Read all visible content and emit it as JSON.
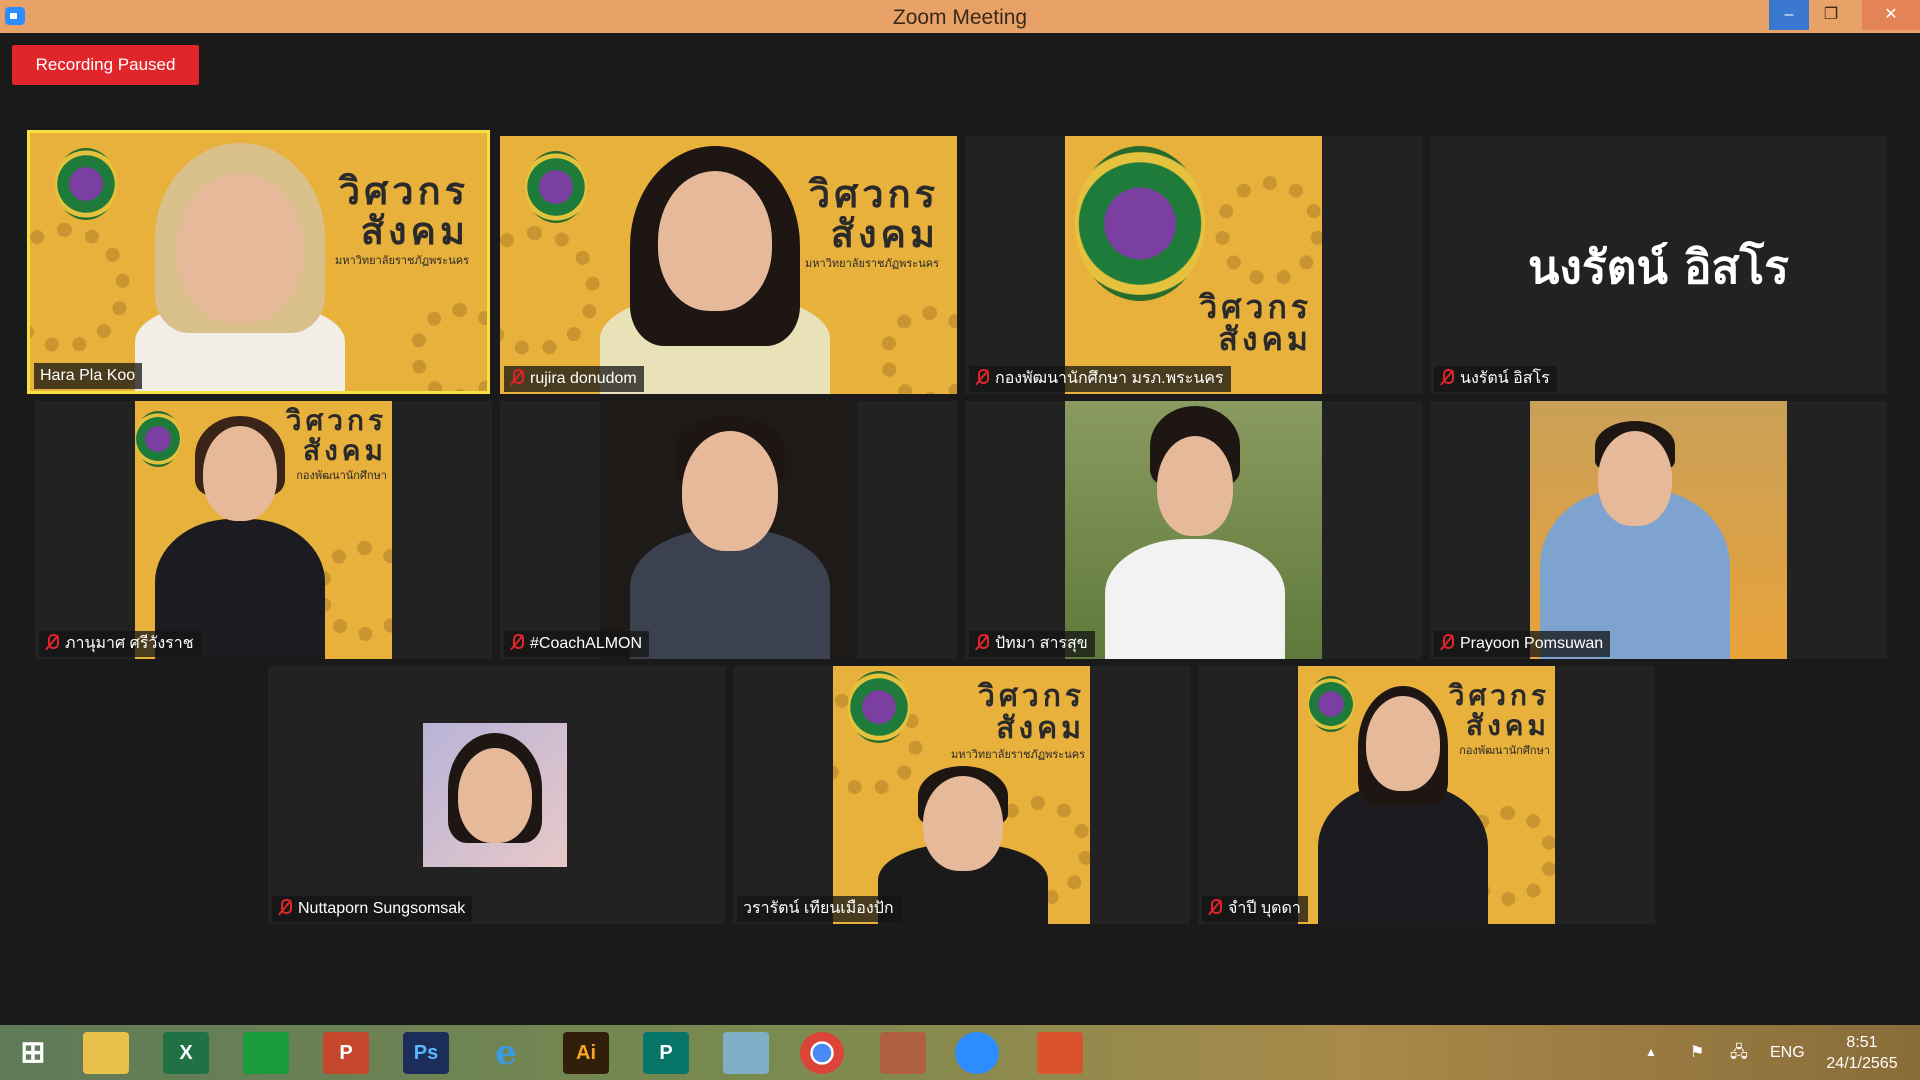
{
  "window": {
    "title": "Zoom Meeting",
    "minimize": "–",
    "restore": "❐",
    "close": "✕"
  },
  "recording_status": "Recording Paused",
  "banner": {
    "title_line1": "วิศวกร",
    "title_line2": "สังคม",
    "university": "มหาวิทยาลัยราชภัฏพระนคร",
    "division": "กองพัฒนานักศึกษา"
  },
  "participants": [
    {
      "name": "Hara Pla Koo",
      "muted": false,
      "active_speaker": true
    },
    {
      "name": "rujira donudom",
      "muted": true
    },
    {
      "name": "กองพัฒนานักศึกษา มรภ.พระนคร",
      "muted": true
    },
    {
      "name": "นงรัตน์ อิสโร",
      "muted": true,
      "display_text": "นงรัตน์ อิสโร"
    },
    {
      "name": "ภานุมาศ ศรีวังราช",
      "muted": true
    },
    {
      "name": "#CoachALMON",
      "muted": true
    },
    {
      "name": "ปัทมา สารสุข",
      "muted": true
    },
    {
      "name": "Prayoon Pomsuwan",
      "muted": true
    },
    {
      "name": "Nuttaporn Sungsomsak",
      "muted": true
    },
    {
      "name": "วรารัตน์ เทียนเมืองปัก",
      "muted": false
    },
    {
      "name": "จำปี บุดดา",
      "muted": true
    }
  ],
  "taskbar": {
    "apps": [
      {
        "icon": "windows-start-icon",
        "label": "⊞"
      },
      {
        "icon": "file-explorer-icon",
        "label": "📁"
      },
      {
        "icon": "excel-icon",
        "label": "X"
      },
      {
        "icon": "store-icon",
        "label": "🛍"
      },
      {
        "icon": "powerpoint-icon",
        "label": "P"
      },
      {
        "icon": "photoshop-icon",
        "label": "Ps"
      },
      {
        "icon": "internet-explorer-icon",
        "label": "e"
      },
      {
        "icon": "illustrator-icon",
        "label": "Ai"
      },
      {
        "icon": "publisher-icon",
        "label": "P"
      },
      {
        "icon": "notepad-icon",
        "label": "✎"
      },
      {
        "icon": "chrome-icon",
        "label": "◉"
      },
      {
        "icon": "paint-icon",
        "label": "🎨"
      },
      {
        "icon": "zoom-icon",
        "label": "■"
      },
      {
        "icon": "photos-icon",
        "label": "▣"
      }
    ],
    "language": "ENG",
    "time": "8:51",
    "date": "24/1/2565"
  },
  "colors": {
    "title_bar": "#e8a267",
    "recording": "#e0252b",
    "active_border": "#f5e241",
    "banner_bg": "#e8b13c"
  }
}
